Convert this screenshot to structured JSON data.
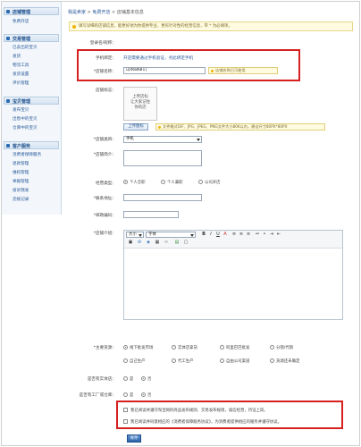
{
  "sidebar": {
    "sections": [
      {
        "title": "店铺管理",
        "items": [
          "免费开店"
        ]
      },
      {
        "title": "交易管理",
        "items": [
          "已卖出的宝贝",
          "发货",
          "物流工具",
          "发货设置",
          "评价管理"
        ]
      },
      {
        "title": "宝贝管理",
        "items": [
          "发布宝贝",
          "出售中的宝贝",
          "仓库中的宝贝"
        ]
      },
      {
        "title": "客户服务",
        "items": [
          "消费者保障服务",
          "退款管理",
          "维权管理",
          "举报管理",
          "投诉我发",
          "违规记录"
        ]
      }
    ]
  },
  "breadcrumb": {
    "home": "我是卖家",
    "sep1": ">",
    "mid": "免费开店",
    "sep2": ">",
    "current": "店铺基本信息"
  },
  "tip": "填写详细的店铺信息，能更好地为你提供专业、更有针对性的经营信息，带 * 为必填项。",
  "form": {
    "login_name_label": "登录名/昵称：",
    "login_name_value": "",
    "phone_label": "手机绑定：",
    "phone_value": "开店需要通过手机验证，点此绑定手机",
    "shop_name_label": "*店铺名称：",
    "shop_name_value": "u[468681]",
    "shop_name_ok": "店铺名称已可使用",
    "logo_label": "店铺标志：",
    "logo_placeholder_1": "上传店标",
    "logo_placeholder_2": "让大家记住",
    "logo_placeholder_3": "你的店",
    "upload_button": "上传图标",
    "upload_hint": "文件格式GIF、JPG、JPEG、PNG文件大小80K以内，建议尺寸80PX*80PX",
    "category_label": "*店铺类目：",
    "category_value": "手机",
    "intro_label": "*店铺简介：",
    "type_label": "经营类型：",
    "type_options": [
      "个人全职",
      "个人兼职",
      "公司开店"
    ],
    "address_label": "*联系地址：",
    "zip_label": "*邮政编码：",
    "desc_label": "*店铺介绍：",
    "font_size": "大小",
    "font_family": "字体",
    "source_label": "*主要货源：",
    "source_options": [
      "线下批发市场",
      "实体店拿货",
      "阿里巴巴批发",
      "分销/代销",
      "自己生产",
      "代工生产",
      "自由公司渠道",
      "货源还未确定"
    ],
    "store_label": "是否有实体店：",
    "factory_label": "是否有工厂或仓库：",
    "yes": "是",
    "no": "否",
    "agree_1": "我已阅读并遵守淘宝网的商品发布规则、交易发布规则，诚信经营，持证上岗。",
    "agree_2": "我已阅读并同意相应的《消费者保障服务协议》，为消费者提供相应的服务并遵守协议。",
    "submit": "保存"
  },
  "colors": {
    "alert_border": "#d62020",
    "link": "#2a5a9a",
    "submit": "#2d63a8"
  }
}
